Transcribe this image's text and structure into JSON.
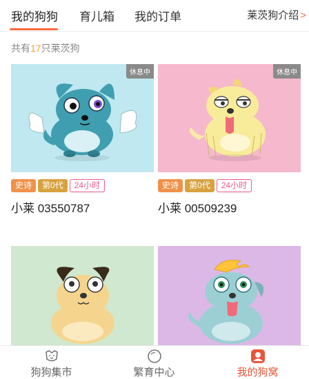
{
  "tabs": [
    {
      "label": "我的狗狗",
      "active": true
    },
    {
      "label": "育儿箱",
      "active": false
    },
    {
      "label": "我的订单",
      "active": false
    }
  ],
  "intro_link": {
    "label": "莱茨狗介绍",
    "icon": "chevron-right-icon"
  },
  "count": {
    "prefix": "共有",
    "value": "17",
    "suffix": "只莱茨狗"
  },
  "dogs": [
    {
      "status": "休息中",
      "bg": "#bfe8f0",
      "tags": [
        "史诗",
        "第0代",
        "24小时"
      ],
      "name": "小莱 03550787"
    },
    {
      "status": "休息中",
      "bg": "#f6b8cc",
      "tags": [
        "史诗",
        "第0代",
        "24小时"
      ],
      "name": "小莱 00509239"
    },
    {
      "status": "",
      "bg": "#cfe8cf",
      "tags": [],
      "name": ""
    },
    {
      "status": "",
      "bg": "#dcb8e6",
      "tags": [],
      "name": ""
    }
  ],
  "bottom_nav": [
    {
      "label": "狗狗集市",
      "icon": "dog-face-icon",
      "active": false
    },
    {
      "label": "繁育中心",
      "icon": "circle-icon",
      "active": false
    },
    {
      "label": "我的狗窝",
      "icon": "profile-icon",
      "active": true
    }
  ],
  "colors": {
    "accent": "#ff6a3d",
    "count_highlight": "#ff9c2a",
    "nav_active": "#e8553a"
  }
}
